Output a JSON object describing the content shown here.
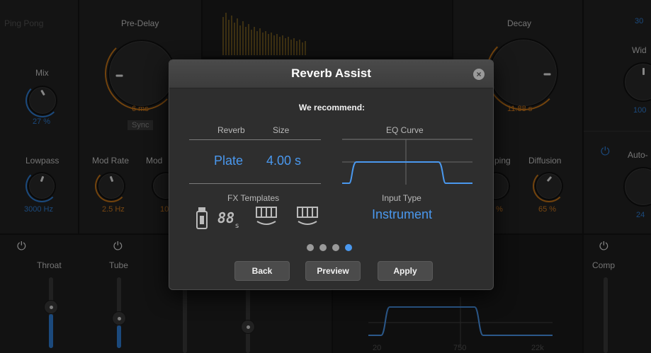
{
  "background": {
    "left_top_label": "Ping Pong",
    "predelay_label": "Pre-Delay",
    "predelay_value": "6 ms",
    "sync_label": "Sync",
    "mix_label": "Mix",
    "mix_value": "27 %",
    "lowpass_label": "Lowpass",
    "lowpass_value": "3000 Hz",
    "modrate_label": "Mod Rate",
    "modrate_value": "2.5 Hz",
    "mod_label": "Mod",
    "mod_value": "10",
    "decay_label": "Decay",
    "decay_value": "11.88 s",
    "width_label": "Wid",
    "width_value": "100",
    "top_right_value": "30",
    "damping_label": "ping",
    "damping_value": "%",
    "diffusion_label": "Diffusion",
    "diffusion_value": "65 %",
    "auto_label": "Auto-",
    "auto_value": "24",
    "throat_label": "Throat",
    "tube_label": "Tube",
    "comp_label": "Comp",
    "eq_axis_20": "20",
    "eq_axis_750": "750",
    "eq_axis_22k": "22k"
  },
  "dialog": {
    "title": "Reverb Assist",
    "recommend": "We recommend:",
    "reverb_header": "Reverb",
    "size_header": "Size",
    "eq_header": "EQ Curve",
    "reverb_value": "Plate",
    "size_value": "4.00 s",
    "fx_templates_label": "FX Templates",
    "input_type_label": "Input Type",
    "input_type_value": "Instrument",
    "pager": {
      "count": 4,
      "active": 4
    },
    "buttons": {
      "back": "Back",
      "preview": "Preview",
      "apply": "Apply"
    }
  },
  "colors": {
    "accent_blue": "#4a98ee",
    "orange": "#c47418"
  }
}
